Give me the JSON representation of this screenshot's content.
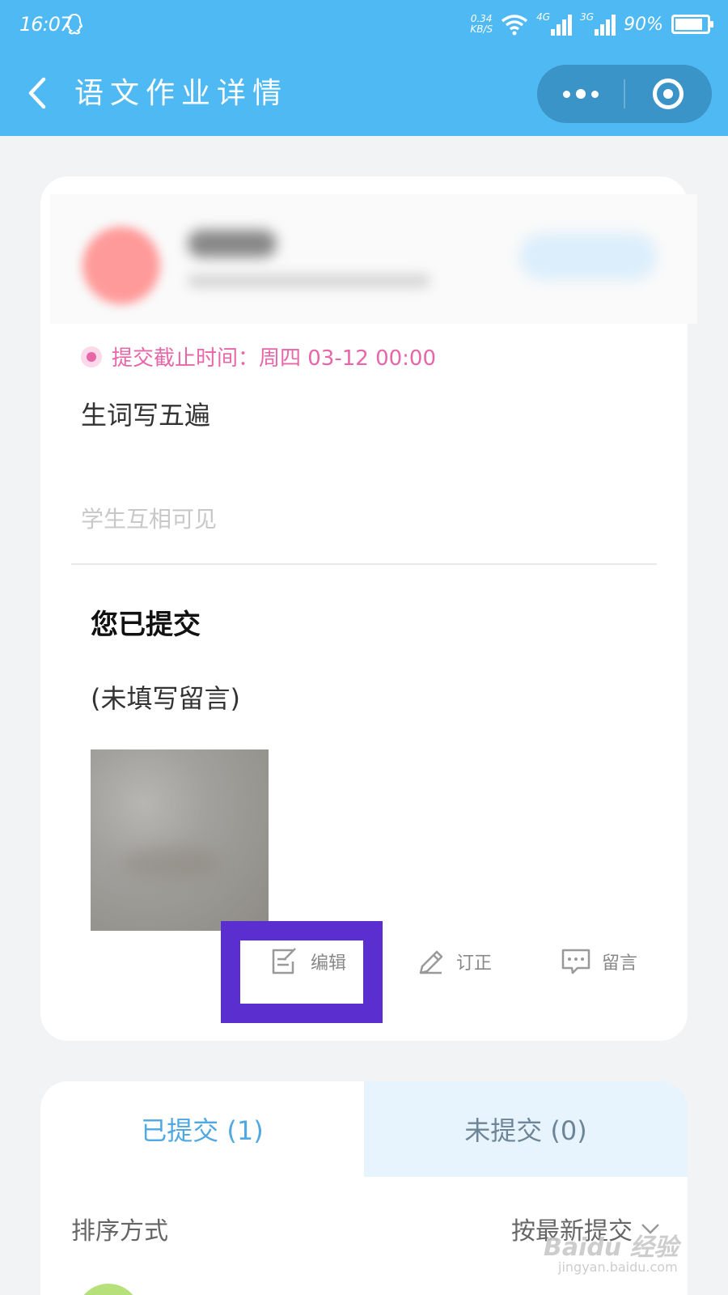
{
  "status_bar": {
    "time": "16:07",
    "net_speed_value": "0.34",
    "net_speed_unit": "KB/S",
    "signal_1": "4G",
    "signal_2": "3G",
    "battery": "90%"
  },
  "nav": {
    "title": "语文作业详情",
    "more_icon": "more-dots-icon",
    "close_icon": "target-close-icon",
    "colors": {
      "bar": "#4fb9f3",
      "capsule": "#3a94c8"
    }
  },
  "homework": {
    "deadline": "提交截止时间：周四 03-12 00:00",
    "content": "生词写五遍",
    "visibility": "学生互相可见",
    "submitted_title": "您已提交",
    "no_message": "(未填写留言)",
    "actions": {
      "edit": "编辑",
      "correct": "订正",
      "comment": "留言"
    },
    "colors": {
      "deadline": "#e866a8",
      "highlight": "#5b2fcf"
    }
  },
  "submissions": {
    "tab_submitted": "已提交 (1)",
    "tab_unsubmitted": "未提交 (0)",
    "sort_label": "排序方式",
    "sort_value": "按最新提交"
  },
  "watermark": {
    "brand": "Baidu 经验",
    "url": "jingyan.baidu.com"
  }
}
